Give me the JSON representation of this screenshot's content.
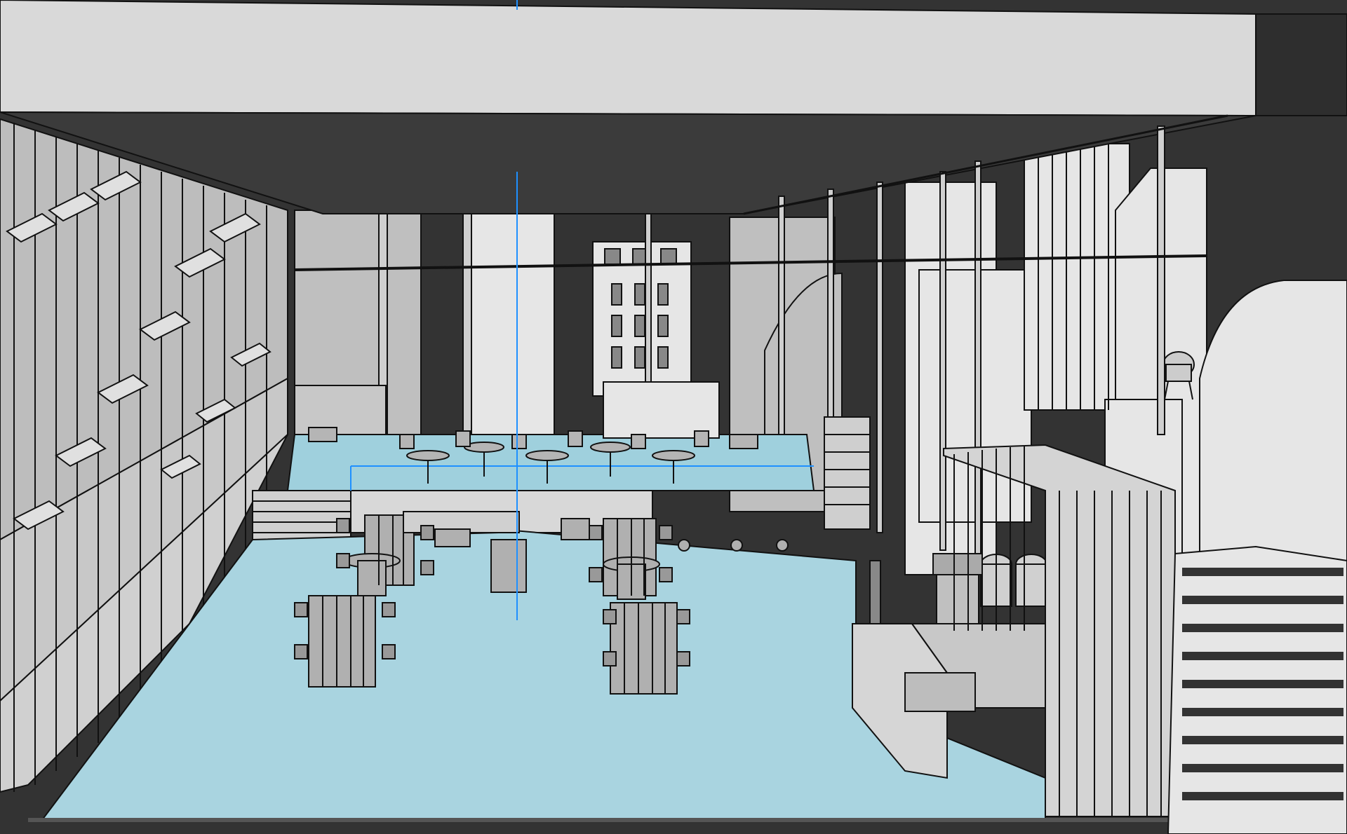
{
  "scene": {
    "kind": "3d-model-viewport",
    "style": "monochrome shaded with cyan floor",
    "colors": {
      "sky": "#333333",
      "ceiling": "#d9d9d9",
      "wall": "#c8c8c8",
      "building_light": "#e6e6e6",
      "building_mid": "#bfbfbf",
      "floor": "#a9d4e0",
      "floor_edge": "#86bccb",
      "furniture": "#b0b0b0",
      "outline": "#111111",
      "guide_line": "#1e90ff"
    }
  }
}
